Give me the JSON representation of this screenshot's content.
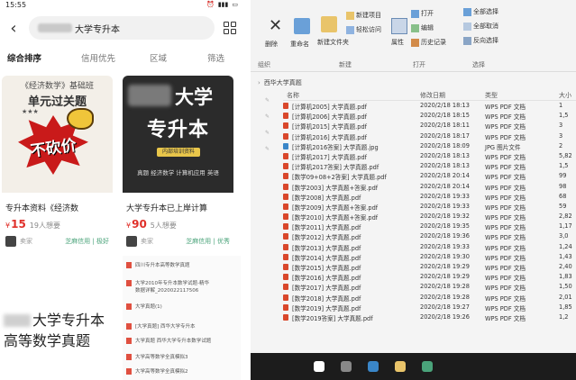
{
  "phone": {
    "status_time": "15:55",
    "search": {
      "query": "大学专升本"
    },
    "filters": [
      "综合排序",
      "信用优先",
      "区域",
      "筛选"
    ],
    "cards": [
      {
        "cover_small": "《经济数学》基础班",
        "cover_title": "单元过关题",
        "cover_burst": "不砍价",
        "title": "专升本资料《经济数",
        "price": "15",
        "wants": "19人想要",
        "seller": "卖家",
        "badge": "芝麻信用 | 极好"
      },
      {
        "cover_line1": "大学",
        "cover_line2": "专升本",
        "cover_badge": "内部培训资料",
        "cover_sub": "真题  经济数学  计算机应用  英语",
        "title": "大学专升本已上岸计算",
        "price": "90",
        "wants": "5人想要",
        "seller": "卖家",
        "badge": "芝麻信用 | 优秀"
      }
    ],
    "bottom_left_text": [
      "大学专升本",
      "高等数学真题"
    ],
    "bottom_right_items": [
      "四川专升本高等数学真题",
      "大学2010年专升本数学试题-精华",
      "数据详解_2020022117506",
      "大学真题(1)",
      "[大学真题] 西华大学专升本",
      "大学真题 西华大学专升本数学试题",
      "大学高等数学全真模拟3",
      "大学高等数学全真模拟2"
    ],
    "currency": "¥"
  },
  "explorer": {
    "ribbon": {
      "new_item": "新建项目",
      "easy_access": "轻松访问",
      "open": "打开",
      "edit": "编辑",
      "history": "历史记录",
      "select_all": "全部选择",
      "select_none": "全部取消",
      "invert": "反向选择",
      "delete": "删除",
      "rename": "重命名",
      "new_folder": "新建文件夹",
      "properties": "属性",
      "group_organize": "组织",
      "group_new": "新建",
      "group_open": "打开",
      "group_select": "选择"
    },
    "breadcrumb": "西华大学真题",
    "columns": {
      "name": "名称",
      "date": "修改日期",
      "type": "类型",
      "size": "大小"
    },
    "files": [
      {
        "name": "[计算机2005] 大学真题.pdf",
        "date": "2020/2/18 18:13",
        "type": "WPS PDF 文档",
        "size": "1",
        "kind": "pdf"
      },
      {
        "name": "[计算机2006] 大学真题.pdf",
        "date": "2020/2/18 18:15",
        "type": "WPS PDF 文档",
        "size": "1,5",
        "kind": "pdf"
      },
      {
        "name": "[计算机2015] 大学真题.pdf",
        "date": "2020/2/18 18:11",
        "type": "WPS PDF 文档",
        "size": "3",
        "kind": "pdf"
      },
      {
        "name": "[计算机2016] 大学真题.pdf",
        "date": "2020/2/18 18:17",
        "type": "WPS PDF 文档",
        "size": "3",
        "kind": "pdf"
      },
      {
        "name": "[计算机2016答案] 大学真题.jpg",
        "date": "2020/2/18 18:09",
        "type": "JPG 图片文件",
        "size": "2",
        "kind": "img"
      },
      {
        "name": "[计算机2017] 大学真题.pdf",
        "date": "2020/2/18 18:13",
        "type": "WPS PDF 文档",
        "size": "5,82",
        "kind": "pdf"
      },
      {
        "name": "[计算机2017答案] 大学真题.pdf",
        "date": "2020/2/18 18:13",
        "type": "WPS PDF 文档",
        "size": "1,5",
        "kind": "pdf"
      },
      {
        "name": "[数学09+08+2答案] 大学真题.pdf",
        "date": "2020/2/18 20:14",
        "type": "WPS PDF 文档",
        "size": "99",
        "kind": "pdf"
      },
      {
        "name": "[数学2003] 大学真题+答案.pdf",
        "date": "2020/2/18 20:14",
        "type": "WPS PDF 文档",
        "size": "98",
        "kind": "pdf"
      },
      {
        "name": "[数学2008] 大学真题.pdf",
        "date": "2020/2/18 19:33",
        "type": "WPS PDF 文档",
        "size": "68",
        "kind": "pdf"
      },
      {
        "name": "[数学2009] 大学真题+答案.pdf",
        "date": "2020/2/18 19:33",
        "type": "WPS PDF 文档",
        "size": "59",
        "kind": "pdf"
      },
      {
        "name": "[数学2010] 大学真题+答案.pdf",
        "date": "2020/2/18 19:32",
        "type": "WPS PDF 文档",
        "size": "2,82",
        "kind": "pdf"
      },
      {
        "name": "[数学2011] 大学真题.pdf",
        "date": "2020/2/18 19:35",
        "type": "WPS PDF 文档",
        "size": "1,17",
        "kind": "pdf"
      },
      {
        "name": "[数学2012] 大学真题.pdf",
        "date": "2020/2/18 19:36",
        "type": "WPS PDF 文档",
        "size": "3,0",
        "kind": "pdf"
      },
      {
        "name": "[数学2013] 大学真题.pdf",
        "date": "2020/2/18 19:33",
        "type": "WPS PDF 文档",
        "size": "1,24",
        "kind": "pdf"
      },
      {
        "name": "[数学2014] 大学真题.pdf",
        "date": "2020/2/18 19:30",
        "type": "WPS PDF 文档",
        "size": "1,43",
        "kind": "pdf"
      },
      {
        "name": "[数学2015] 大学真题.pdf",
        "date": "2020/2/18 19:29",
        "type": "WPS PDF 文档",
        "size": "2,40",
        "kind": "pdf"
      },
      {
        "name": "[数学2016] 大学真题.pdf",
        "date": "2020/2/18 19:29",
        "type": "WPS PDF 文档",
        "size": "1,83",
        "kind": "pdf"
      },
      {
        "name": "[数学2017] 大学真题.pdf",
        "date": "2020/2/18 19:28",
        "type": "WPS PDF 文档",
        "size": "1,50",
        "kind": "pdf"
      },
      {
        "name": "[数学2018] 大学真题.pdf",
        "date": "2020/2/18 19:28",
        "type": "WPS PDF 文档",
        "size": "2,01",
        "kind": "pdf"
      },
      {
        "name": "[数学2019] 大学真题.pdf",
        "date": "2020/2/18 19:27",
        "type": "WPS PDF 文档",
        "size": "1,85",
        "kind": "pdf"
      },
      {
        "name": "[数学2019答案] 大学真题.pdf",
        "date": "2020/2/18 19:26",
        "type": "WPS PDF 文档",
        "size": "1,2",
        "kind": "pdf"
      }
    ]
  }
}
